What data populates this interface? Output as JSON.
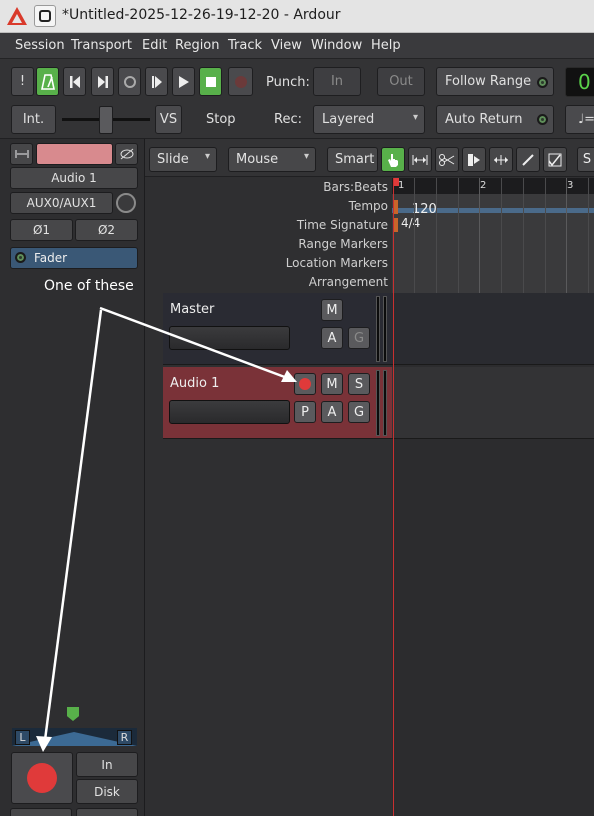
{
  "window": {
    "title": "*Untitled-2025-12-26-19-12-20 - Ardour"
  },
  "menu": [
    "Session",
    "Transport",
    "Edit",
    "Region",
    "Track",
    "View",
    "Window",
    "Help"
  ],
  "toolbar": {
    "punch_label": "Punch:",
    "punch_in": "In",
    "punch_out": "Out",
    "follow_range": "Follow Range",
    "rec_label": "Rec:",
    "rec_mode": "Layered",
    "auto_return": "Auto Return",
    "int": "Int.",
    "vs": "VS",
    "stop": "Stop",
    "clock": "0",
    "clock2": "♩="
  },
  "strip": {
    "name": "Audio 1",
    "io": "AUX0/AUX1",
    "phase1": "Ø1",
    "phase2": "Ø2",
    "processor": "Fader",
    "pan_left": "L",
    "pan_right": "R",
    "input_in": "In",
    "input_disk": "Disk"
  },
  "editor": {
    "edit_mode": "Slide",
    "edit_point": "Mouse",
    "smart": "Smart",
    "ruler_labels": [
      "Bars:Beats",
      "Tempo",
      "Time Signature",
      "Range Markers",
      "Location Markers",
      "Arrangement"
    ],
    "bar_numbers": [
      "1",
      "2",
      "3"
    ],
    "tempo_value": "120",
    "time_sig_value": "4/4"
  },
  "tracks": [
    {
      "name": "Master",
      "buttons": [
        "M",
        "A",
        "G"
      ]
    },
    {
      "name": "Audio 1",
      "buttons": [
        "M",
        "S",
        "P",
        "A",
        "G"
      ]
    }
  ],
  "annotation": {
    "text": "One of these"
  },
  "colors": {
    "record_red": "#e03a3a",
    "accent_green": "#58b04a",
    "track_selected": "#7a3238"
  }
}
